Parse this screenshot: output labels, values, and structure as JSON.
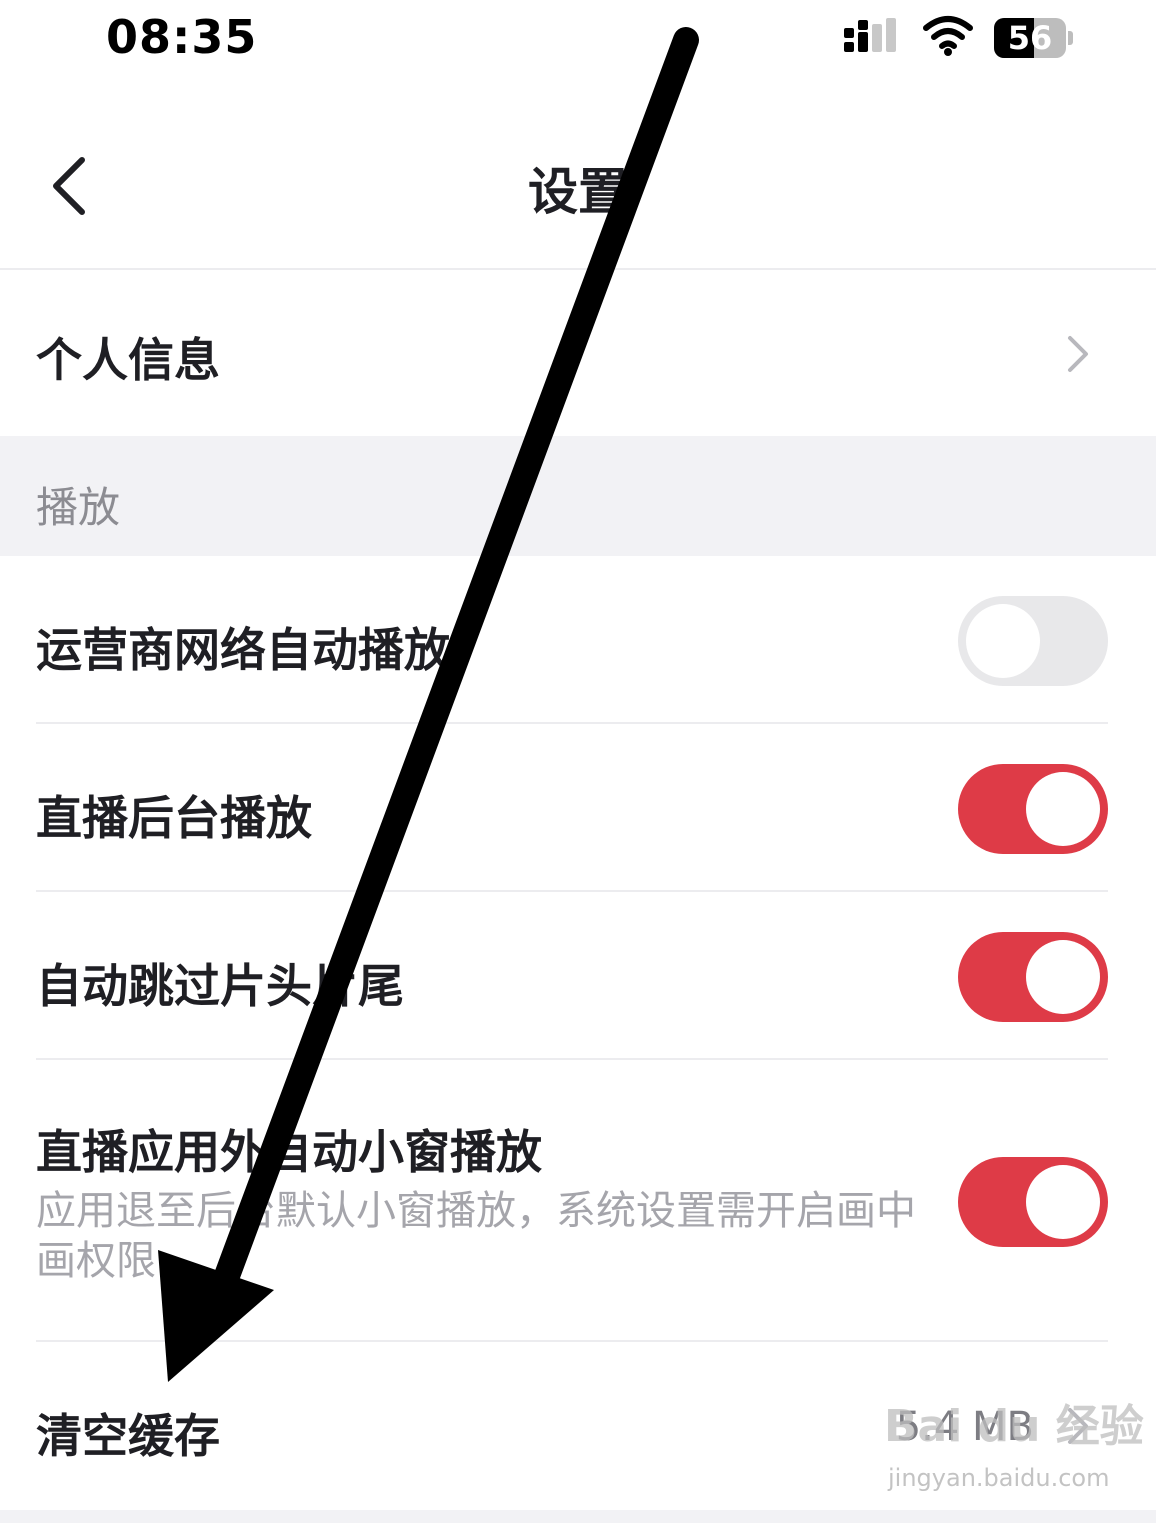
{
  "status_bar": {
    "time": "08:35",
    "battery_percent": 56,
    "battery_label": "56"
  },
  "nav": {
    "title": "设置"
  },
  "rows": {
    "personal_info": {
      "label": "个人信息"
    },
    "section_play": {
      "title": "播放"
    },
    "carrier_autoplay": {
      "label": "运营商网络自动播放",
      "enabled": false
    },
    "live_background": {
      "label": "直播后台播放",
      "enabled": true
    },
    "skip_intro": {
      "label": "自动跳过片头片尾",
      "enabled": true
    },
    "live_pip": {
      "label": "直播应用外自动小窗播放",
      "description": "应用退至后台默认小窗播放，系统设置需开启画中画权限",
      "enabled": true
    },
    "clear_cache": {
      "label": "清空缓存",
      "value": "5.4 MB"
    }
  },
  "colors": {
    "toggle_on": "#de3b47",
    "toggle_off": "#e8e8ea",
    "section_bg": "#f2f2f5",
    "annotation_arrow": "#000000"
  },
  "watermark": {
    "logo": "Bai du 经验",
    "url": "jingyan.baidu.com"
  }
}
